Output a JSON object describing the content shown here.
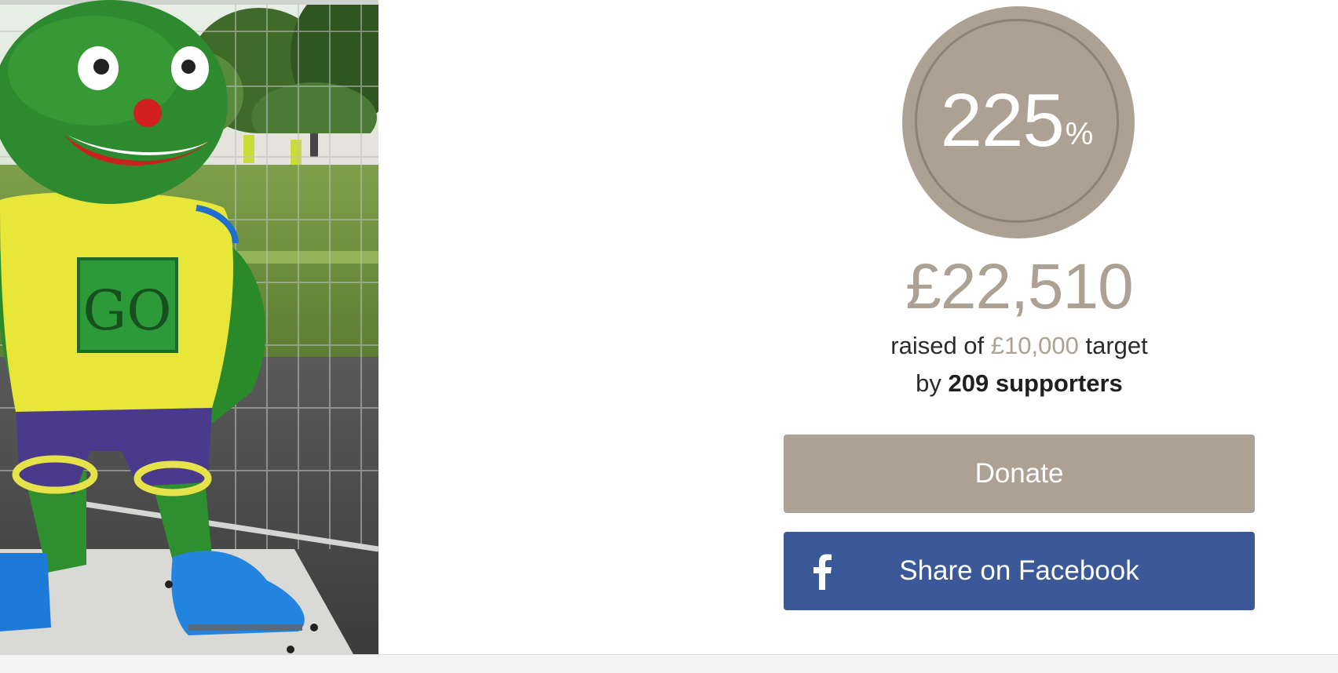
{
  "photo": {
    "shirt_text": "GO",
    "icon": "mascot-photo"
  },
  "progress": {
    "percent": "225",
    "percent_sign": "%",
    "percent_value": 225
  },
  "raised": {
    "amount": "£22,510",
    "prefix": "raised of",
    "target": "£10,000",
    "suffix": "target"
  },
  "supporters": {
    "prefix": "by",
    "count": "209 supporters"
  },
  "buttons": {
    "donate_label": "Donate",
    "facebook_label": "Share on Facebook",
    "facebook_icon": "facebook-icon"
  },
  "colors": {
    "accent": "#ada194",
    "facebook": "#3b5998"
  }
}
